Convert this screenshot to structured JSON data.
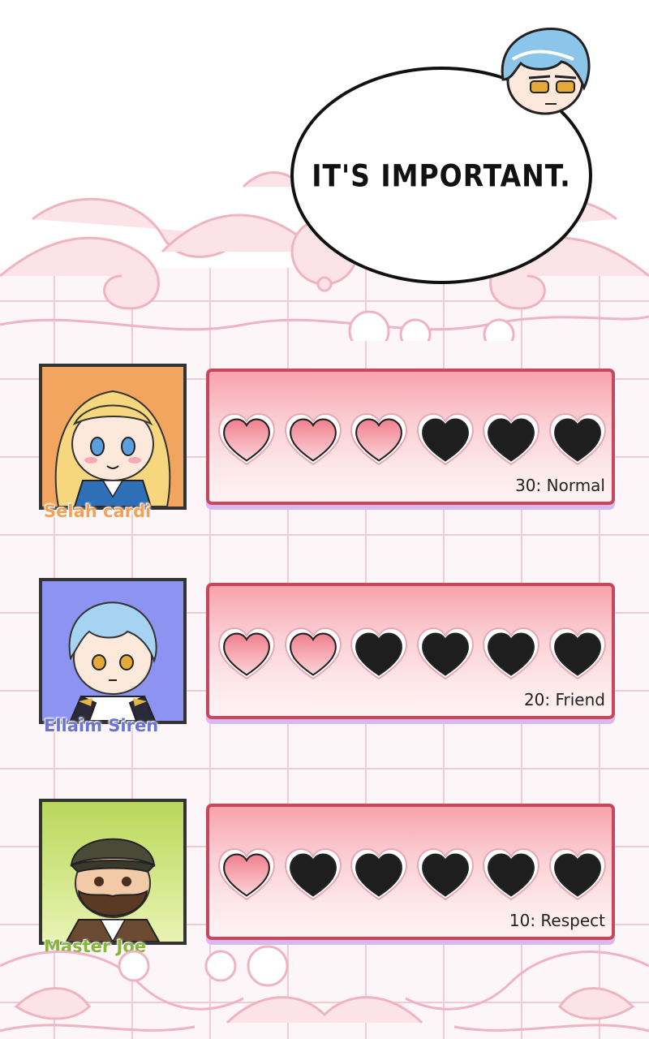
{
  "speech": {
    "text": "IT'S IMPORTANT."
  },
  "characters": [
    {
      "name": "Selah cardi",
      "name_color": "#f3a15a",
      "portrait_bg": "#f2a55f",
      "filled_hearts": 3,
      "total_hearts": 6,
      "label": "30: Normal"
    },
    {
      "name": "Ellaim Siren",
      "name_color": "#6a73d6",
      "portrait_bg": "#8c93f0",
      "filled_hearts": 2,
      "total_hearts": 6,
      "label": "20: Friend"
    },
    {
      "name": "Master Joe",
      "name_color": "#86b53a",
      "portrait_bg": "#c9e07a",
      "filled_hearts": 1,
      "total_hearts": 6,
      "label": "10: Respect"
    }
  ],
  "colors": {
    "heart_filled": "#f07f8e",
    "heart_empty": "#1e1e1e",
    "panel_border": "#c9475e",
    "grid_line": "#f2cbd6"
  }
}
